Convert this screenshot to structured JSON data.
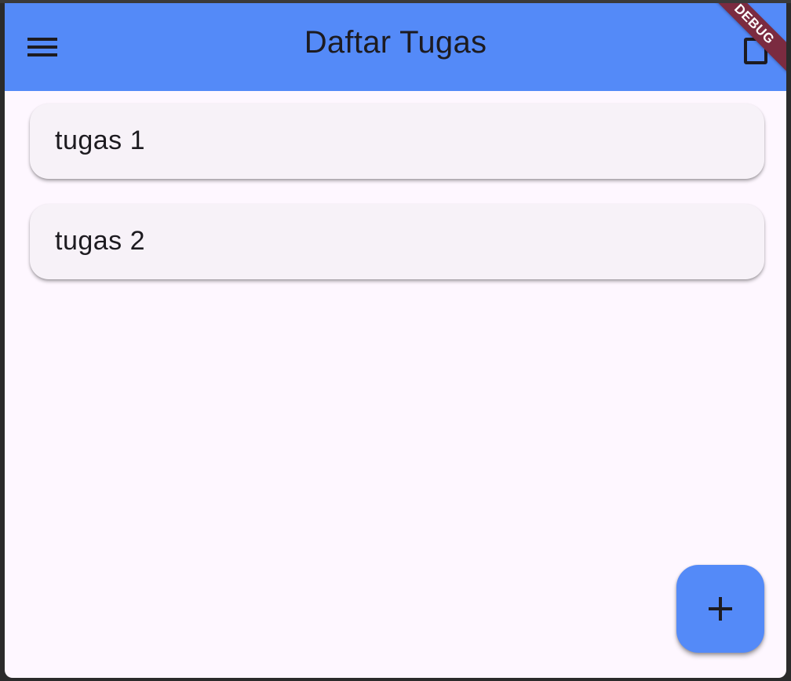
{
  "appbar": {
    "title": "Daftar Tugas",
    "menu_icon": "menu-icon",
    "action_icon": "square-icon",
    "color": "#548af8"
  },
  "debug_banner": {
    "label": "DEBUG",
    "color": "#7b2b40"
  },
  "tasks": [
    {
      "label": "tugas 1"
    },
    {
      "label": "tugas 2"
    }
  ],
  "fab": {
    "icon": "plus-icon",
    "color": "#548af8"
  },
  "colors": {
    "background": "#fef7ff",
    "card": "#f7f2f8",
    "text": "#1d1b20"
  }
}
